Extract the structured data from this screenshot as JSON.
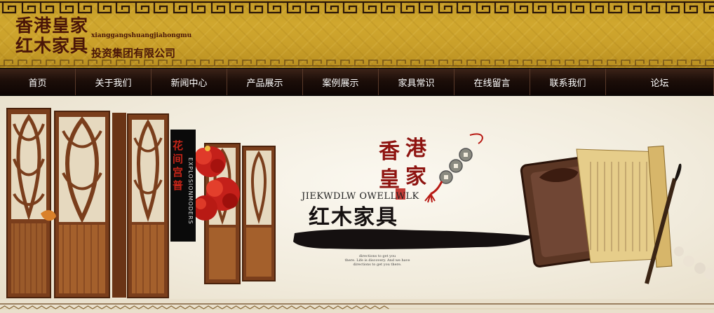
{
  "header": {
    "logo_cn_line1": "香港皇家",
    "logo_cn_line2": "红木家具",
    "logo_pinyin": "xianggangshuangjiahongmu",
    "logo_company": "投资集团有限公司",
    "colors": {
      "gold": "#c9a02a",
      "logo_text": "#4a1608",
      "fret": "#2a1608"
    }
  },
  "nav": {
    "items": [
      {
        "label": "首页"
      },
      {
        "label": "关于我们"
      },
      {
        "label": "新闻中心"
      },
      {
        "label": "产品展示"
      },
      {
        "label": "案例展示"
      },
      {
        "label": "家具常识"
      },
      {
        "label": "在线留言"
      },
      {
        "label": "联系我们"
      },
      {
        "label": "论坛"
      }
    ]
  },
  "banner": {
    "calligraphy_chars": [
      "香",
      "港",
      "皇",
      "家"
    ],
    "tagline": "JIEKWDLW OWELLWLK",
    "title": "红木家具",
    "small_lines": [
      "directions to get you",
      "there. Life is discovery. And we have",
      "directions to get you there."
    ],
    "book_title_cn": "花间宫普",
    "book_title_en": "EXPLOSIONMODERS",
    "colors": {
      "ink": "#151010",
      "seal_red": "#8e1410",
      "wood": "#7a3e1c"
    }
  }
}
